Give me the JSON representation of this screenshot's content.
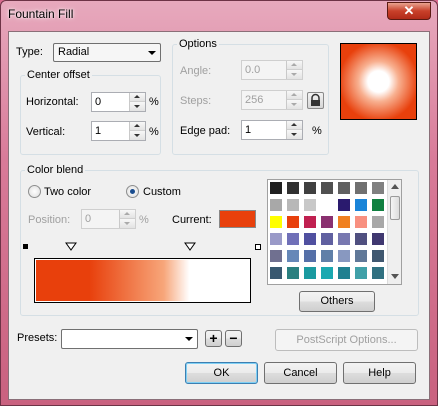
{
  "window": {
    "title": "Fountain Fill",
    "close_glyph": "✕"
  },
  "type": {
    "label": "Type:",
    "value": "Radial"
  },
  "center_offset": {
    "title": "Center offset",
    "horizontal_label": "Horizontal:",
    "horizontal_value": "0",
    "horizontal_unit": "%",
    "vertical_label": "Vertical:",
    "vertical_value": "1",
    "vertical_unit": "%"
  },
  "options": {
    "title": "Options",
    "angle_label": "Angle:",
    "angle_value": "0.0",
    "steps_label": "Steps:",
    "steps_value": "256",
    "edge_pad_label": "Edge pad:",
    "edge_pad_value": "1",
    "edge_pad_unit": "%"
  },
  "color_blend": {
    "title": "Color blend",
    "two_color_label": "Two color",
    "custom_label": "Custom",
    "selected_mode": "custom",
    "position_label": "Position:",
    "position_value": "0",
    "position_unit": "%",
    "current_label": "Current:",
    "current_color": "#e8400c"
  },
  "gradient": {
    "start_color": "#e8400c",
    "end_color": "#ffffff"
  },
  "preview": {
    "outer_color": "#e8400c",
    "inner_color": "#ffffff"
  },
  "palette_colors": [
    "#202020",
    "#303030",
    "#404040",
    "#505050",
    "#606060",
    "#707070",
    "#808080",
    "#a8a8a8",
    "#b8b8b8",
    "#c8c8c8",
    "#ffffff",
    "#2a1a6e",
    "#1a84d8",
    "#108040",
    "#ffff00",
    "#e8400c",
    "#c02050",
    "#8a3070",
    "#f08020",
    "#f89080",
    "#a8a8a8",
    "#9a9ac8",
    "#7070b8",
    "#5050a0",
    "#6060a0",
    "#7878b0",
    "#505080",
    "#403870",
    "#707090",
    "#6688b8",
    "#5570a8",
    "#6080a8",
    "#8898c0",
    "#607898",
    "#405870",
    "#385870",
    "#2a8080",
    "#1a9aa0",
    "#1aa8b0",
    "#208090",
    "#40a0a8",
    "#307080"
  ],
  "others_label": "Others",
  "presets": {
    "label": "Presets:",
    "value": ""
  },
  "postscript_label": "PostScript Options...",
  "buttons": {
    "ok": "OK",
    "cancel": "Cancel",
    "help": "Help"
  },
  "preset_add_glyph": "+",
  "preset_remove_glyph": "−"
}
